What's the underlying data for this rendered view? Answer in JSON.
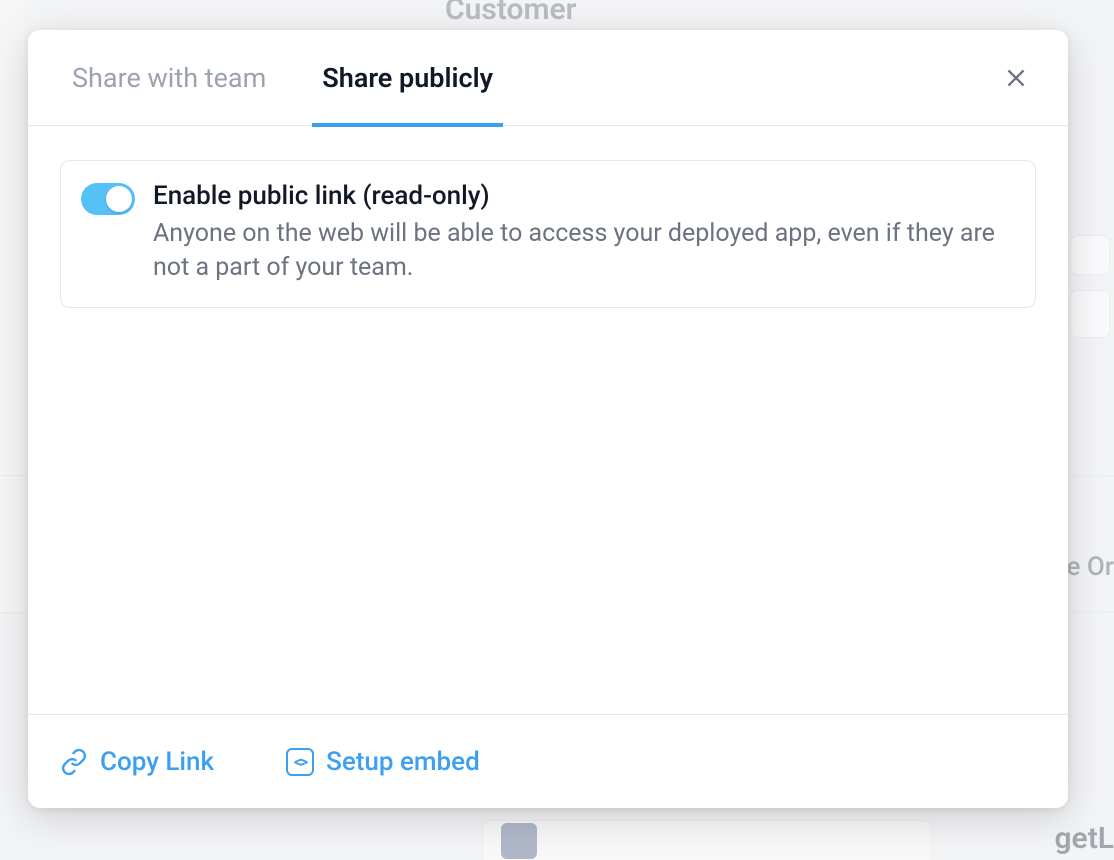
{
  "tabs": {
    "team": "Share with team",
    "public": "Share publicly"
  },
  "card": {
    "title": "Enable public link (read-only)",
    "description": "Anyone on the web will be able to access your deployed app, even if they are not a part of your team."
  },
  "footer": {
    "copy": "Copy Link",
    "embed": "Setup embed"
  },
  "background": {
    "title_fragment": "Customer",
    "right_fragment": "e Or",
    "bottom_fragment": "getL"
  }
}
